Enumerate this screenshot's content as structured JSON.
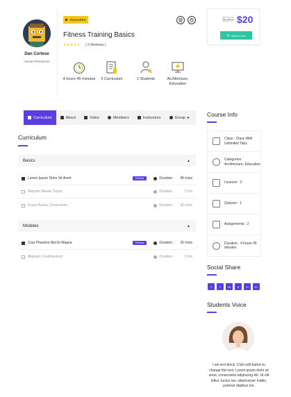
{
  "instructor": {
    "name": "Dan Cortese",
    "role": "Human Resources"
  },
  "course": {
    "badge": "FEATURED",
    "title": "Fitness Training Basics",
    "stars": "★★★★★",
    "reviews": "( 2 Reviews )",
    "meta": [
      {
        "icon": "clock-icon",
        "label": "4 hours 45 minutes"
      },
      {
        "icon": "curriculum-icon",
        "label": "5 Curriculum"
      },
      {
        "icon": "students-icon",
        "label": "2 Students"
      },
      {
        "icon": "monitor-icon",
        "label": "Architecture, Education"
      }
    ]
  },
  "pricing": {
    "old": "$30",
    "new": "$20",
    "cart_label": "Add to Cart"
  },
  "tabs": [
    "Curriculum",
    "About",
    "Video",
    "Members",
    "Instructors",
    "Group"
  ],
  "curriculum": {
    "title": "Curriculum",
    "groups": [
      {
        "name": "Basics",
        "lessons": [
          {
            "title": "Lorem Ipsum Dolor Sit Amet",
            "preview": "Preview",
            "duration_label": "Duration :",
            "duration": "45 mins"
          },
          {
            "title": "Aliquam Massa Turpis",
            "duration_label": "Duration :",
            "duration": "2 hrs"
          },
          {
            "title": "Fusce Auctor Consectetur",
            "duration_label": "Duration :",
            "duration": "30 mins"
          }
        ]
      },
      {
        "name": "Modules",
        "lessons": [
          {
            "title": "Cras Pharetra Nisl Et Magna",
            "preview": "Preview",
            "duration_label": "Duration :",
            "duration": "30 mins"
          },
          {
            "title": "Aliquam Condimentum",
            "duration_label": "Duration :",
            "duration": "2 hrs"
          }
        ]
      }
    ]
  },
  "course_info": {
    "title": "Course Info",
    "rows": [
      {
        "icon": "class-icon",
        "text": "Class : Class With Unlimited Tabs"
      },
      {
        "icon": "categories-icon",
        "text": "Categories : Architecture, Education"
      },
      {
        "icon": "lessons-icon",
        "text": "Lessons : 2"
      },
      {
        "icon": "quizzes-icon",
        "text": "Quizzes : 1"
      },
      {
        "icon": "assignments-icon",
        "text": "Assignments : 2"
      },
      {
        "icon": "duration-icon",
        "text": "Duration : 4 hours 45 minutes"
      }
    ]
  },
  "social": {
    "title": "Social Share",
    "icons": [
      "facebook-icon",
      "twitter-icon",
      "vk-icon",
      "delicious-icon",
      "linkedin-icon",
      "google-plus-icon"
    ],
    "glyphs": [
      "f",
      "t",
      "vk",
      "d",
      "in",
      "G+"
    ]
  },
  "voice": {
    "title": "Students Voice",
    "text": "I am text block. Click edit button to change this text. Lorem ipsum dolor sit amet, consectetur adipiscing elit. Ut elit tellus, luctus nec ullamcorper mattis, pulvinar dapibus leo."
  },
  "colors": {
    "accent": "#5c3de0",
    "cart": "#2ec4a4",
    "badge": "#f5c518"
  }
}
